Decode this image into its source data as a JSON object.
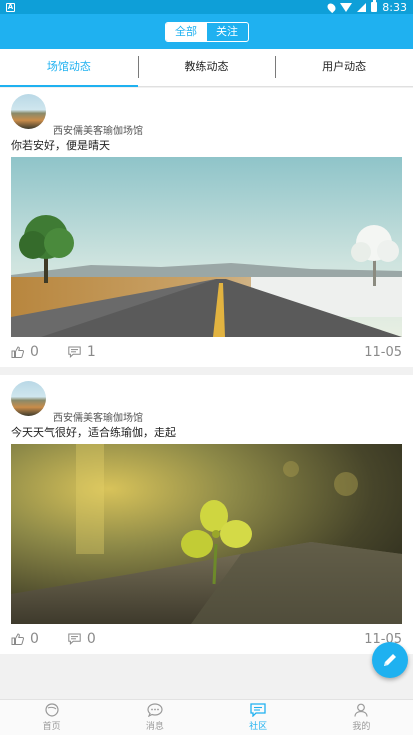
{
  "status_bar": {
    "time": "8:33",
    "icons": [
      "notification-icon",
      "location-icon",
      "wifi-icon",
      "cell-signal-icon",
      "battery-icon"
    ]
  },
  "header": {
    "segments": [
      {
        "label": "全部",
        "active": true
      },
      {
        "label": "关注",
        "active": false
      }
    ]
  },
  "tabs": [
    {
      "label": "场馆动态",
      "active": true
    },
    {
      "label": "教练动态",
      "active": false
    },
    {
      "label": "用户动态",
      "active": false
    }
  ],
  "posts": [
    {
      "author": "西安儒美客瑜伽场馆",
      "text": "你若安好，便是晴天",
      "image": "road-landscape-photo",
      "likes": "0",
      "comments": "1",
      "date": "11-05"
    },
    {
      "author": "西安儒美客瑜伽场馆",
      "text": "今天天气很好，适合练瑜伽，走起",
      "image": "clover-photo",
      "likes": "0",
      "comments": "0",
      "date": "11-05"
    }
  ],
  "fab": {
    "icon": "pencil-icon"
  },
  "bottom_nav": [
    {
      "label": "首页",
      "icon": "home-icon",
      "active": false
    },
    {
      "label": "消息",
      "icon": "message-icon",
      "active": false
    },
    {
      "label": "社区",
      "icon": "community-icon",
      "active": true
    },
    {
      "label": "我的",
      "icon": "profile-icon",
      "active": false
    }
  ],
  "colors": {
    "accent": "#1fb1f0",
    "status_bar": "#0e9fd8",
    "muted": "#8a8a8a"
  }
}
